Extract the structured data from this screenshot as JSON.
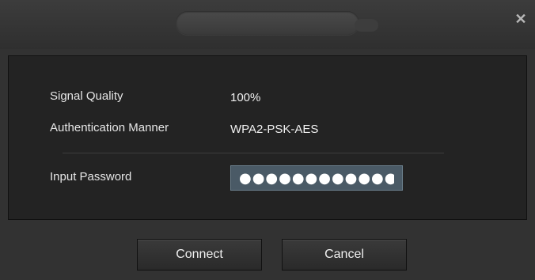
{
  "dialog": {
    "close_icon": "close-icon"
  },
  "info": {
    "signal_quality_label": "Signal Quality",
    "signal_quality_value": "100%",
    "auth_label": "Authentication Manner",
    "auth_value": "WPA2-PSK-AES"
  },
  "password": {
    "label": "Input Password",
    "value": "●●●●●●●●●●●●"
  },
  "buttons": {
    "connect_label": "Connect",
    "cancel_label": "Cancel"
  }
}
